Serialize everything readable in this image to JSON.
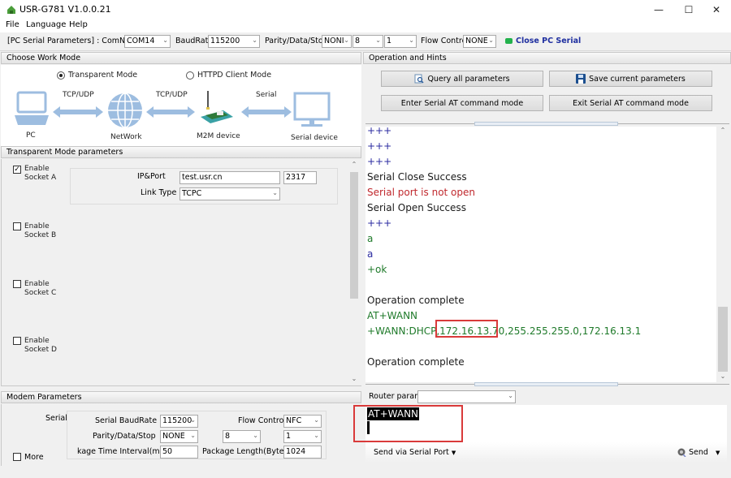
{
  "window": {
    "title": "USR-G781 V1.0.0.21",
    "logo_icon": "app-logo-icon",
    "controls": [
      "minimize",
      "maximize",
      "close"
    ]
  },
  "menu": [
    "File",
    "Language",
    "Help"
  ],
  "toolbar": {
    "pc_serial_label": "[PC Serial Parameters] : ComName",
    "comname": "COM14",
    "baudrate_label": "BaudRate",
    "baudrate": "115200",
    "pds_label": "Parity/Data/Stop",
    "parity": "NONI",
    "data_bits": "8",
    "stop_bits": "1",
    "flow_label": "Flow Control",
    "flow": "NONE",
    "status_color": "#22b14c",
    "close_serial_label": "Close PC Serial",
    "close_serial_color": "#1f2fa0"
  },
  "work_mode": {
    "header": "Choose Work Mode",
    "modes": [
      {
        "label": "Transparent Mode",
        "selected": true
      },
      {
        "label": "HTTPD Client Mode",
        "selected": false
      }
    ],
    "diagram": {
      "nodes": [
        "PC",
        "NetWork",
        "M2M device",
        "Serial device"
      ],
      "links": [
        "TCP/UDP",
        "TCP/UDP",
        "Serial"
      ]
    }
  },
  "transparent": {
    "header": "Transparent Mode parameters",
    "sockets": [
      {
        "line1": "Enable",
        "line2": "Socket A",
        "checked": true
      },
      {
        "line1": "Enable",
        "line2": "Socket B",
        "checked": false
      },
      {
        "line1": "Enable",
        "line2": "Socket C",
        "checked": false
      },
      {
        "line1": "Enable",
        "line2": "Socket D",
        "checked": false
      }
    ],
    "ip_port_label": "IP&Port",
    "ip": "test.usr.cn",
    "port": "2317",
    "link_type_label": "Link Type",
    "link_type": "TCPC"
  },
  "modem": {
    "header": "Modem Parameters",
    "serial_label": "Serial",
    "baud_label": "Serial BaudRate",
    "baud": "115200",
    "flow_label": "Flow Control",
    "flow": "NFC",
    "pds_label": "Parity/Data/Stop",
    "parity": "NONE",
    "data_bits": "8",
    "stop_bits": "1",
    "interval_label": "kage Time Interval(ms)",
    "interval": "50",
    "pkglen_label": "Package Length(Bytes)",
    "pkglen": "1024",
    "more_label": "More"
  },
  "operation": {
    "header": "Operation and Hints",
    "buttons": {
      "query": "Query all parameters",
      "save": "Save current parameters",
      "enter_at": "Enter Serial AT command mode",
      "exit_at": "Exit Serial AT command mode"
    },
    "log": [
      {
        "text": "+++",
        "color": "#2b2ba0"
      },
      {
        "text": "+++",
        "color": "#2b2ba0"
      },
      {
        "text": "+++",
        "color": "#2b2ba0"
      },
      {
        "text": "Serial Close Success",
        "color": "#1a1a1a"
      },
      {
        "text": "Serial port is not open",
        "color": "#c0282d"
      },
      {
        "text": "Serial Open Success",
        "color": "#1a1a1a"
      },
      {
        "text": "+++",
        "color": "#2b2ba0"
      },
      {
        "text": "a",
        "color": "#1f7a2a"
      },
      {
        "text": "a",
        "color": "#2b2ba0"
      },
      {
        "text": "+ok",
        "color": "#1f7a2a"
      },
      {
        "text": "",
        "color": "#1a1a1a"
      },
      {
        "text": "Operation complete",
        "color": "#1a1a1a"
      },
      {
        "text": "AT+WANN",
        "color": "#1f7a2a"
      },
      {
        "text": "+WANN:DHCP,172.16.13.70,255.255.255.0,172.16.13.1",
        "color": "#1f7a2a"
      },
      {
        "text": "",
        "color": "#1a1a1a"
      },
      {
        "text": "Operation complete",
        "color": "#1a1a1a"
      }
    ],
    "highlighted_ip": "172.16.13.70",
    "router_params_label": "Router params",
    "router_params_value": "",
    "command_input": "AT+WANN",
    "send_via_label": "Send via Serial Port",
    "send_label": "Send",
    "highlight_color": "#d93a3a"
  }
}
